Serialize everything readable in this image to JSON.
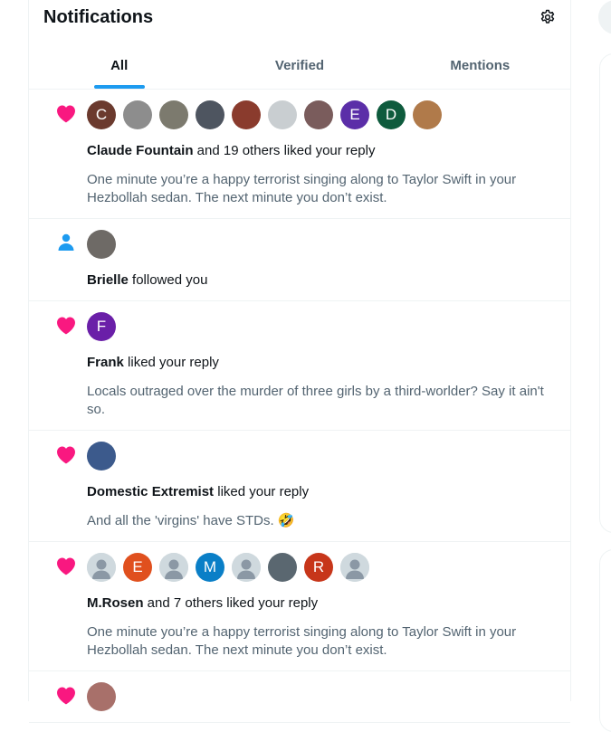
{
  "header": {
    "title": "Notifications",
    "settings_icon": "gear-icon"
  },
  "tabs": [
    {
      "label": "All",
      "active": true
    },
    {
      "label": "Verified",
      "active": false
    },
    {
      "label": "Mentions",
      "active": false
    }
  ],
  "colors": {
    "accent": "#1d9bf0",
    "like": "#f91880",
    "follow": "#1d9bf0",
    "secondary_text": "#536471",
    "border": "#eff3f4"
  },
  "notifications": [
    {
      "type": "like",
      "icon": "heart-icon",
      "avatars": [
        {
          "letter": "C",
          "color": "#6b3a2e"
        },
        {
          "letter": "",
          "color": "#8d8d8d"
        },
        {
          "letter": "",
          "color": "#7c7a6e"
        },
        {
          "letter": "",
          "color": "#4e5560"
        },
        {
          "letter": "",
          "color": "#8a3b2d"
        },
        {
          "letter": "",
          "color": "#c9ced1"
        },
        {
          "letter": "",
          "color": "#7a5c5c"
        },
        {
          "letter": "E",
          "color": "#5b2ea8"
        },
        {
          "letter": "D",
          "color": "#0e5b3d"
        },
        {
          "letter": "",
          "color": "#b07a4a"
        }
      ],
      "actor": "Claude Fountain",
      "text": " and 19 others liked your reply",
      "snippet": "One minute you’re a happy terrorist singing along to Taylor Swift in your Hezbollah sedan. The next minute you don’t exist."
    },
    {
      "type": "follow",
      "icon": "person-icon",
      "avatars": [
        {
          "letter": "",
          "color": "#6e6a66"
        }
      ],
      "actor": "Brielle",
      "text": " followed you",
      "snippet": ""
    },
    {
      "type": "like",
      "icon": "heart-icon",
      "avatars": [
        {
          "letter": "F",
          "color": "#6a1fa8"
        }
      ],
      "actor": "Frank",
      "text": " liked your reply",
      "snippet": "Locals outraged over the murder of three girls by a third-worlder?  Say it ain't so."
    },
    {
      "type": "like",
      "icon": "heart-icon",
      "avatars": [
        {
          "letter": "",
          "color": "#3c5a8c"
        }
      ],
      "actor": "Domestic Extremist",
      "text": " liked your reply",
      "snippet": "And all the 'virgins' have STDs. 🤣"
    },
    {
      "type": "like",
      "icon": "heart-icon",
      "avatars": [
        {
          "letter": "",
          "color": "default"
        },
        {
          "letter": "E",
          "color": "#e0501e"
        },
        {
          "letter": "",
          "color": "default"
        },
        {
          "letter": "M",
          "color": "#0a7fc7"
        },
        {
          "letter": "",
          "color": "default"
        },
        {
          "letter": "",
          "color": "#5a6770"
        },
        {
          "letter": "R",
          "color": "#c7361a"
        },
        {
          "letter": "",
          "color": "default"
        }
      ],
      "actor": "M.Rosen",
      "text": " and 7 others liked your reply",
      "snippet": "One minute you’re a happy terrorist singing along to Taylor Swift in your Hezbollah sedan. The next minute you don’t exist."
    },
    {
      "type": "like",
      "icon": "heart-icon",
      "avatars": [
        {
          "letter": "",
          "color": "#a8706a"
        }
      ],
      "actor": "",
      "text": "",
      "snippet": ""
    }
  ]
}
